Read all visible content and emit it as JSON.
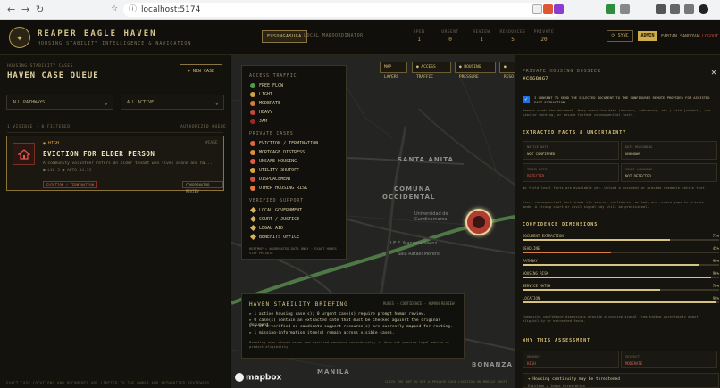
{
  "browser": {
    "url": "localhost:5174"
  },
  "header": {
    "brand": "REAPER EAGLE HAVEN",
    "tagline": "HOUSING STABILITY INTELLIGENCE & NAVIGATION",
    "nav": [
      "FUSUNGASUGA",
      "LOCAL MAP",
      "COORDINATOR"
    ],
    "stats": [
      {
        "label": "OPEN",
        "value": "1"
      },
      {
        "label": "URGENT",
        "value": "0"
      },
      {
        "label": "REVIEW",
        "value": "1"
      },
      {
        "label": "RESOURCES",
        "value": "5"
      },
      {
        "label": "PRIVATE",
        "value": "20"
      }
    ],
    "sync": "⟳ SYNC",
    "admin": "ADMIN",
    "user": "FABIAN SANDOVAL",
    "logout": "LOGOUT"
  },
  "left": {
    "subtitle": "HOUSING STABILITY CASES",
    "title": "HAVEN CASE QUEUE",
    "new_case": "+ NEW CASE",
    "pathways_filter": "ALL PATHWAYS",
    "status_filter": "ALL ACTIVE",
    "visible_count": "1 VISIBLE · 0 FILTERED",
    "authorized_queue": "AUTHORIZED QUEUE",
    "case": {
      "priority": "HIGH",
      "id": "#CASE",
      "title": "EVICTION FOR ELDER PERSON",
      "description": "A community volunteer refers an older tenant who lives alone and ha...",
      "meta": "● LVL 5   ● AUTO 44.55",
      "tag": "EVICTION / TERMINATION",
      "review": "COORDINATOR REVIEW"
    },
    "footer": "EXACT CASE LOCATIONS AND DOCUMENTS ARE LIMITED TO THE OWNER AND AUTHORIZED REVIEWERS"
  },
  "map": {
    "legend_access": "ACCESS TRAFFIC",
    "access_items": [
      {
        "label": "FREE FLOW",
        "color": "#4f9d42"
      },
      {
        "label": "LIGHT",
        "color": "#d1a242"
      },
      {
        "label": "MODERATE",
        "color": "#d17c3b"
      },
      {
        "label": "HEAVY",
        "color": "#c7473b"
      },
      {
        "label": "JAM",
        "color": "#9b2b25"
      }
    ],
    "legend_private": "PRIVATE CASES",
    "private_items": [
      {
        "label": "EVICTION / TERMINATION",
        "color": "#e0663d"
      },
      {
        "label": "MORTGAGE DISTRESS",
        "color": "#dc8d3d"
      },
      {
        "label": "UNSAFE HOUSING",
        "color": "#e35c43"
      },
      {
        "label": "UTILITY SHUTOFF",
        "color": "#d9a63e"
      },
      {
        "label": "DISPLACEMENT",
        "color": "#d64d3a"
      },
      {
        "label": "OTHER HOUSING RISK",
        "color": "#e07b3e"
      }
    ],
    "legend_verified": "VERIFIED SUPPORT",
    "verified_items": [
      {
        "label": "LOCAL GOVERNMENT"
      },
      {
        "label": "COURT / JUSTICE"
      },
      {
        "label": "LEGAL AID"
      },
      {
        "label": "BENEFITS OFFICE"
      }
    ],
    "legend_footer": "HEATMAP = AGGREGATED DATA ONLY · EXACT HOMES STAY PRIVATE",
    "top_buttons": [
      "MAP LAYERS",
      "● ACCESS TRAFFIC",
      "● HOUSING PRESSURE",
      "● RESO"
    ],
    "places": [
      "SANTA ANITA",
      "COMUNA",
      "OCCIDENTAL",
      "MANILA",
      "BONANZA"
    ],
    "small_places": [
      "Universidad de Cundinamarca",
      "I.E.E. Manuela Sáenz",
      "Sala Rafael Moreno"
    ],
    "briefing_title": "HAVEN STABILITY BRIEFING",
    "briefing_meta": "RULES · CONFIDENCE · HUMAN REVIEW",
    "briefing_lines": [
      "▸ 1 active housing case(s); 0 urgent case(s) require prompt human review.",
      "▸ 0 case(s) contain an extracted date that must be checked against the original document.",
      "▸ 0 of 0 verified or candidate support resource(s) are currently mapped for routing.",
      "▸ 1 missing-information item(s) remain across visible cases."
    ],
    "briefing_note": "Briefing uses stored cases and verified resource records only; it does not provide legal advice or predict eligibility.",
    "mapbox": "mapbox",
    "bottom_note": "CLICK THE MAP TO SET A PRIVATE CASE LOCATION ON MOBILE ROUTE"
  },
  "panel": {
    "label": "PRIVATE HOUSING DOSSIER",
    "case_id": "#C068867",
    "consent": "I CONSENT TO SEND THE SELECTED DOCUMENT TO THE CONFIGURED REMOTE PROVIDER FOR ASSISTED FACT EXTRACTION",
    "consent_note": "Remote sends the document. Wrap sensitive data (amounts, addresses, etc.) with [redact], use similar wording, or ensure further consequential facts.",
    "extracted_title": "EXTRACTED FACTS & UNCERTAINTY",
    "facts": [
      {
        "k": "NOTICE DATE",
        "v": "NOT CONFIRMED",
        "danger": false
      },
      {
        "k": "DATE REASONING",
        "v": "UNKNOWN",
        "danger": false
      },
      {
        "k": "TERMS MATCH",
        "v": "DETECTED",
        "danger": true
      },
      {
        "k": "COURT LANGUAGE",
        "v": "NOT DETECTED",
        "danger": false
      }
    ],
    "facts_note": "No field-level facts are available yet. Upload a document or provide readable notice text.",
    "facts_note2": "Every consequential fact shows its source, confidence, method, and review gaps in private mode. A strong court or civil signal may still be provisional.",
    "confidence_title": "CONFIDENCE DIMENSIONS",
    "dimensions": [
      {
        "label": "DOCUMENT EXTRACTION",
        "pct": "75%",
        "value": 0.75,
        "color": "#d7c380"
      },
      {
        "label": "DEADLINE",
        "pct": "45%",
        "value": 0.45,
        "color": "#d77d45"
      },
      {
        "label": "PATHWAY",
        "pct": "90%",
        "value": 0.9,
        "color": "#d7c380"
      },
      {
        "label": "HOUSING RISK",
        "pct": "96%",
        "value": 0.96,
        "color": "#d7c380"
      },
      {
        "label": "SERVICE MATCH",
        "pct": "70%",
        "value": 0.7,
        "color": "#d7c380"
      },
      {
        "label": "LOCATION",
        "pct": "98%",
        "value": 0.98,
        "color": "#d7c380"
      }
    ],
    "confidence_note": "Composite confidence dimensions provide a concise signal from hiding uncertainty about eligibility or extracted facts.",
    "why_title": "WHY THIS ASSESSMENT",
    "why": [
      {
        "k": "URGENCY",
        "v": "HIGH"
      },
      {
        "k": "SEVERITY",
        "v": "MODERATE"
      }
    ],
    "reason_title": "+ Housing continuity may be threatened",
    "reason_subtitle": "Eviction / lease termination"
  },
  "colors": {
    "accent": "#d2ad4b",
    "danger": "#c44a3b"
  }
}
